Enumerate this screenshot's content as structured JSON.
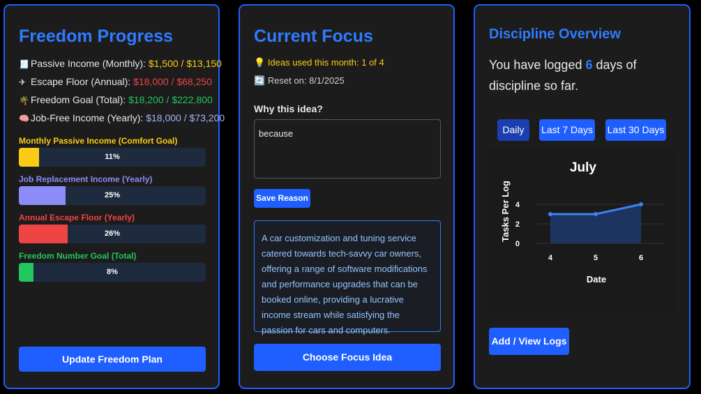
{
  "freedom": {
    "title": "Freedom Progress",
    "stats": [
      {
        "icon": "receipt-icon",
        "glyph": "🧾",
        "label": "Passive Income (Monthly):",
        "value": "$1,500 / $13,150",
        "color": "yel"
      },
      {
        "icon": "plane-icon",
        "glyph": "✈",
        "label": "Escape Floor (Annual):",
        "value": "$18,000 / $68,250",
        "color": "red"
      },
      {
        "icon": "palm-tree-icon",
        "glyph": "🌴",
        "label": "Freedom Goal (Total):",
        "value": "$18,200 / $222,800",
        "color": "grn"
      },
      {
        "icon": "brain-icon",
        "glyph": "🧠",
        "label": "Job-Free Income (Yearly):",
        "value": "$18,000 / $73,200",
        "color": "prp"
      }
    ],
    "bars": [
      {
        "label": "Monthly Passive Income (Comfort Goal)",
        "pct_text": "11%",
        "fraction": 0.11,
        "color": "#facc15"
      },
      {
        "label": "Job Replacement Income (Yearly)",
        "pct_text": "25%",
        "fraction": 0.25,
        "color": "#8b8cf8"
      },
      {
        "label": "Annual Escape Floor (Yearly)",
        "pct_text": "26%",
        "fraction": 0.26,
        "color": "#ef4444"
      },
      {
        "label": "Freedom Number Goal (Total)",
        "pct_text": "8%",
        "fraction": 0.08,
        "color": "#22c55e"
      }
    ],
    "update_button": "Update Freedom Plan"
  },
  "focus": {
    "title": "Current Focus",
    "ideas_used": "Ideas used this month: 1 of 4",
    "reset_on": "Reset on: 8/1/2025",
    "why_label": "Why this idea?",
    "why_value": "because",
    "save_button": "Save Reason",
    "idea_text": "A car customization and tuning service catered towards tech-savvy car owners, offering a range of software modifications and performance upgrades that can be booked online, providing a lucrative income stream while satisfying the passion for cars and computers.",
    "choose_button": "Choose Focus Idea"
  },
  "discipline": {
    "title": "Discipline Overview",
    "logged_prefix": "You have logged ",
    "logged_days": "6",
    "logged_suffix": " days of discipline so far.",
    "ranges": [
      "Daily",
      "Last 7 Days",
      "Last 30 Days"
    ],
    "active_range": "Daily",
    "logs_button": "Add / View Logs"
  },
  "chart_data": {
    "type": "area",
    "title": "July",
    "xlabel": "Date",
    "ylabel": "Tasks Per Log",
    "x": [
      "4",
      "5",
      "6"
    ],
    "series": [
      {
        "values": [
          3,
          3,
          4
        ]
      }
    ],
    "yticks": [
      "0",
      "2",
      "4"
    ],
    "ylim": [
      0,
      4
    ],
    "line_color": "#3b82f6",
    "fill_color": "#1e3a6e"
  }
}
